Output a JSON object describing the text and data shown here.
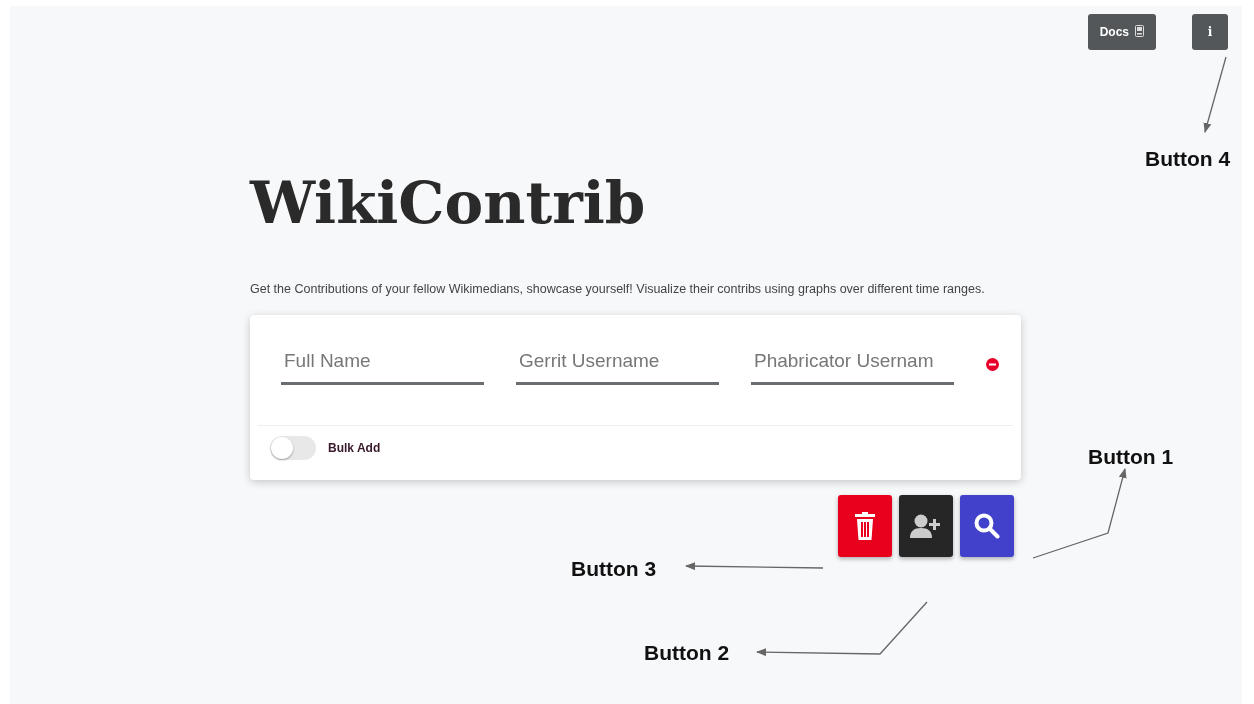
{
  "top_buttons": [
    {
      "kind": "docs",
      "label": "Docs"
    },
    {
      "kind": "info",
      "label": "i"
    }
  ],
  "title": "WikiContrib",
  "description": "Get the Contributions of your fellow Wikimedians, showcase yourself! Visualize their contribs using graphs over different time ranges.",
  "fields": [
    {
      "placeholder": "Full Name"
    },
    {
      "placeholder": "Gerrit Username"
    },
    {
      "placeholder": "Phabricator Usernam"
    }
  ],
  "bulk_add": {
    "label": "Bulk Add",
    "on": false
  },
  "action_buttons": [
    {
      "kind": "delete"
    },
    {
      "kind": "add-user"
    },
    {
      "kind": "search"
    }
  ],
  "annotations": [
    {
      "kind": "info",
      "label": "Button 4"
    },
    {
      "kind": "search",
      "label": "Button 1"
    },
    {
      "kind": "delete",
      "label": "Button 3"
    },
    {
      "kind": "add-user",
      "label": "Button 2"
    }
  ]
}
